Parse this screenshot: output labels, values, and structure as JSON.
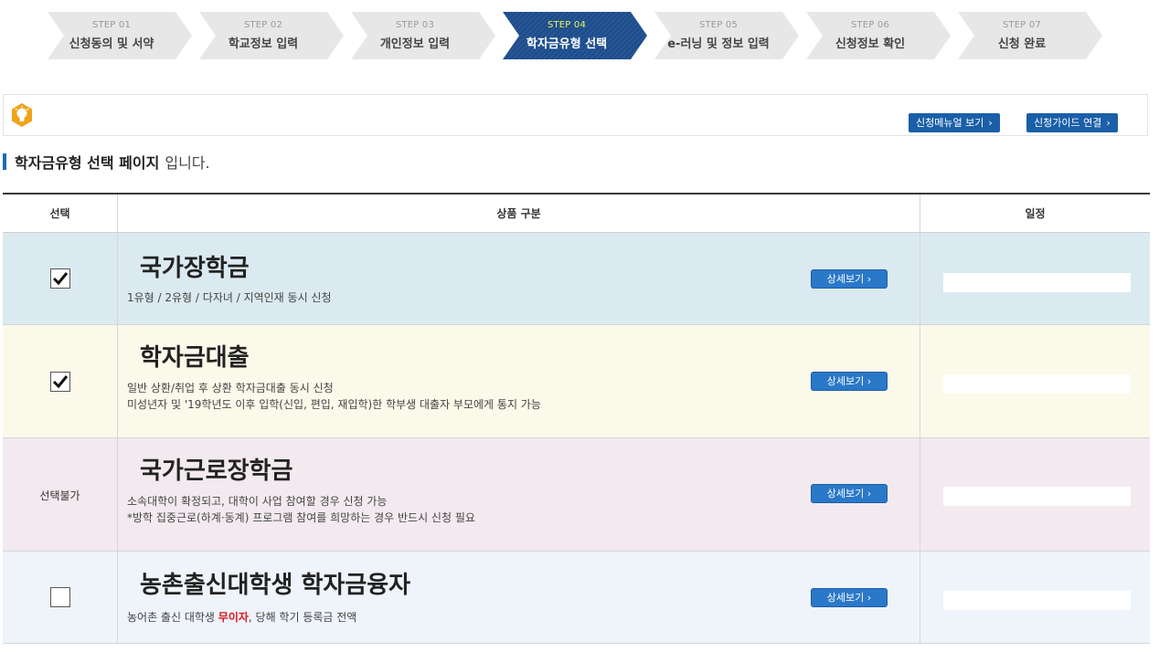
{
  "steps": [
    {
      "num": "STEP 01",
      "label": "신청동의 및 서약"
    },
    {
      "num": "STEP 02",
      "label": "학교정보 입력"
    },
    {
      "num": "STEP 03",
      "label": "개인정보 입력"
    },
    {
      "num": "STEP 04",
      "label": "학자금유형 선택"
    },
    {
      "num": "STEP 05",
      "label": "e-러닝 및 정보 입력"
    },
    {
      "num": "STEP 06",
      "label": "신청정보 확인"
    },
    {
      "num": "STEP 07",
      "label": "신청 완료"
    }
  ],
  "active_step": 4,
  "guide": {
    "manual_label": "신청메뉴얼 보기",
    "guide_label": "신청가이드 연결",
    "arrow": "›"
  },
  "heading": {
    "strong": "학자금유형 선택 페이지",
    "rest": "입니다."
  },
  "table": {
    "headers": [
      "선택",
      "상품 구분",
      "일정"
    ],
    "detail_label": "상세보기 ›",
    "rows": [
      {
        "title": "국가장학금",
        "select_state": "checked",
        "desc1": "1유형 / 2유형 / 다자녀 / 지역인재 동시 신청",
        "desc2": ""
      },
      {
        "title": "학자금대출",
        "select_state": "checked",
        "desc1": "일반 상환/취업 후 상환 학자금대출 동시 신청",
        "desc2": "미성년자 및 '19학년도 이후 입학(신입, 편입, 재입학)한 학부생 대출자 부모에게 통지 가능"
      },
      {
        "title": "국가근로장학금",
        "select_state": "unavailable",
        "select_label": "선택불가",
        "desc1": "소속대학이 확정되고, 대학이 사업 참여할 경우 신청 가능",
        "desc2": "*방학 집중근로(하계·동계) 프로그램 참여를 희망하는 경우 반드시 신청 필요"
      },
      {
        "title": "농촌출신대학생 학자금융자",
        "select_state": "unchecked",
        "desc_a": "농어촌 출신 대학생",
        "desc_red": "무이자",
        "desc_b": ", 당해 학기 등록금 전액"
      }
    ]
  },
  "colors": {
    "row_bg": [
      "#dbeaf0",
      "#fbf9e9",
      "#f2eaef",
      "#eef4fa"
    ],
    "step_inactive": "#e7e7e7",
    "step_active": "#1f4d8a",
    "button_blue": "#1a5fa8",
    "red_text": "#e2141b"
  },
  "icons": {
    "info": "lightbulb-icon",
    "check": "checkmark-icon"
  }
}
